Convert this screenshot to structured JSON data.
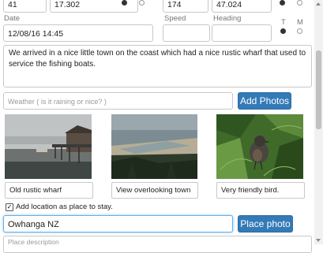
{
  "location": {
    "num1": "41",
    "lat": "17.302",
    "num2": "174",
    "lon": "47.024"
  },
  "date": {
    "label": "Date",
    "value": "12/08/16 14:45"
  },
  "speed": {
    "label": "Speed",
    "value": ""
  },
  "heading": {
    "label": "Heading",
    "value": ""
  },
  "units": {
    "true_label": "T",
    "magnetic_label": "M",
    "selected": "T"
  },
  "description": "We arrived in a nice little town on the coast which had a nice rustic wharf that used to service the fishing boats.",
  "weather": {
    "placeholder": "Weather ( is it raining or nice? )",
    "value": ""
  },
  "add_photos_label": "Add Photos",
  "photos": [
    {
      "caption": "Old rustic wharf",
      "icon": "wharf-photo"
    },
    {
      "caption": "View overlooking town",
      "icon": "coast-photo"
    },
    {
      "caption": "Very friendly bird.",
      "icon": "bird-photo"
    }
  ],
  "add_location": {
    "label": "Add location as place to stay.",
    "checked": true
  },
  "place": {
    "value": "Owhanga NZ",
    "button_label": "Place photo"
  },
  "place_description": {
    "placeholder": "Place description"
  }
}
